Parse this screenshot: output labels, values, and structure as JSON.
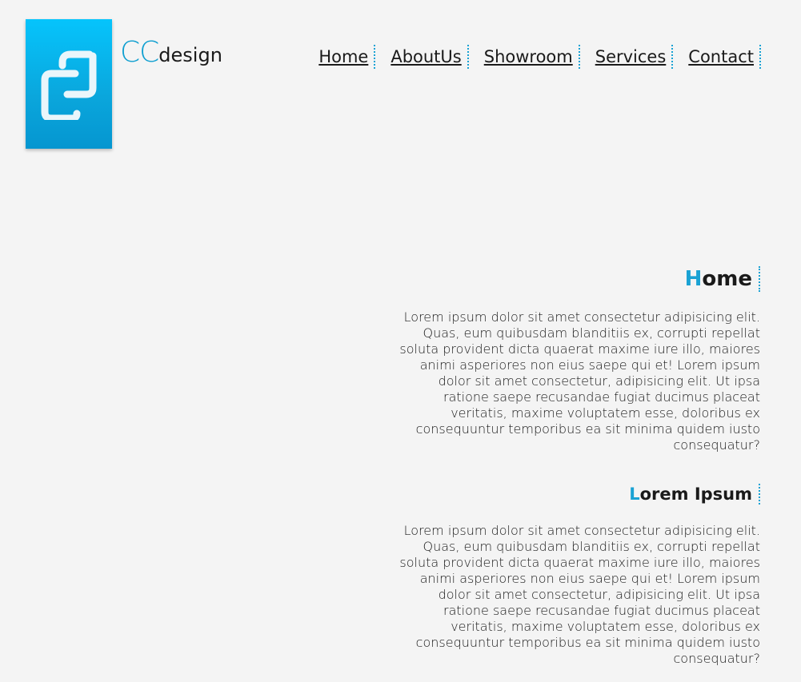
{
  "logo": {
    "icon": "cc-logo-icon",
    "brand_cc": "CC",
    "brand_design": "design"
  },
  "nav": {
    "items": [
      {
        "label": "Home"
      },
      {
        "label": "AboutUs"
      },
      {
        "label": "Showroom"
      },
      {
        "label": "Services"
      },
      {
        "label": "Contact"
      }
    ]
  },
  "sections": [
    {
      "title_first": "H",
      "title_rest": "ome",
      "body": "Lorem ipsum dolor sit amet consectetur adipisicing elit. Quas, eum quibusdam blanditiis ex, corrupti repellat soluta provident dicta quaerat maxime iure illo, maiores animi asperiores non eius saepe qui et! Lorem ipsum dolor sit amet consectetur, adipisicing elit. Ut ipsa ratione saepe recusandae fugiat ducimus placeat veritatis, maxime voluptatem esse, doloribus ex consequuntur temporibus ea sit minima quidem iusto consequatur?"
    },
    {
      "title_first": "L",
      "title_rest": "orem Ipsum",
      "body": "Lorem ipsum dolor sit amet consectetur adipisicing elit. Quas, eum quibusdam blanditiis ex, corrupti repellat soluta provident dicta quaerat maxime iure illo, maiores animi asperiores non eius saepe qui et! Lorem ipsum dolor sit amet consectetur, adipisicing elit. Ut ipsa ratione saepe recusandae fugiat ducimus placeat veritatis, maxime voluptatem esse, doloribus ex consequuntur temporibus ea sit minima quidem iusto consequatur?"
    }
  ],
  "colors": {
    "accent": "#1aa2d4",
    "logo_gradient_top": "#06c4fc",
    "logo_gradient_bottom": "#0596d0",
    "background": "#f4f4f4"
  }
}
